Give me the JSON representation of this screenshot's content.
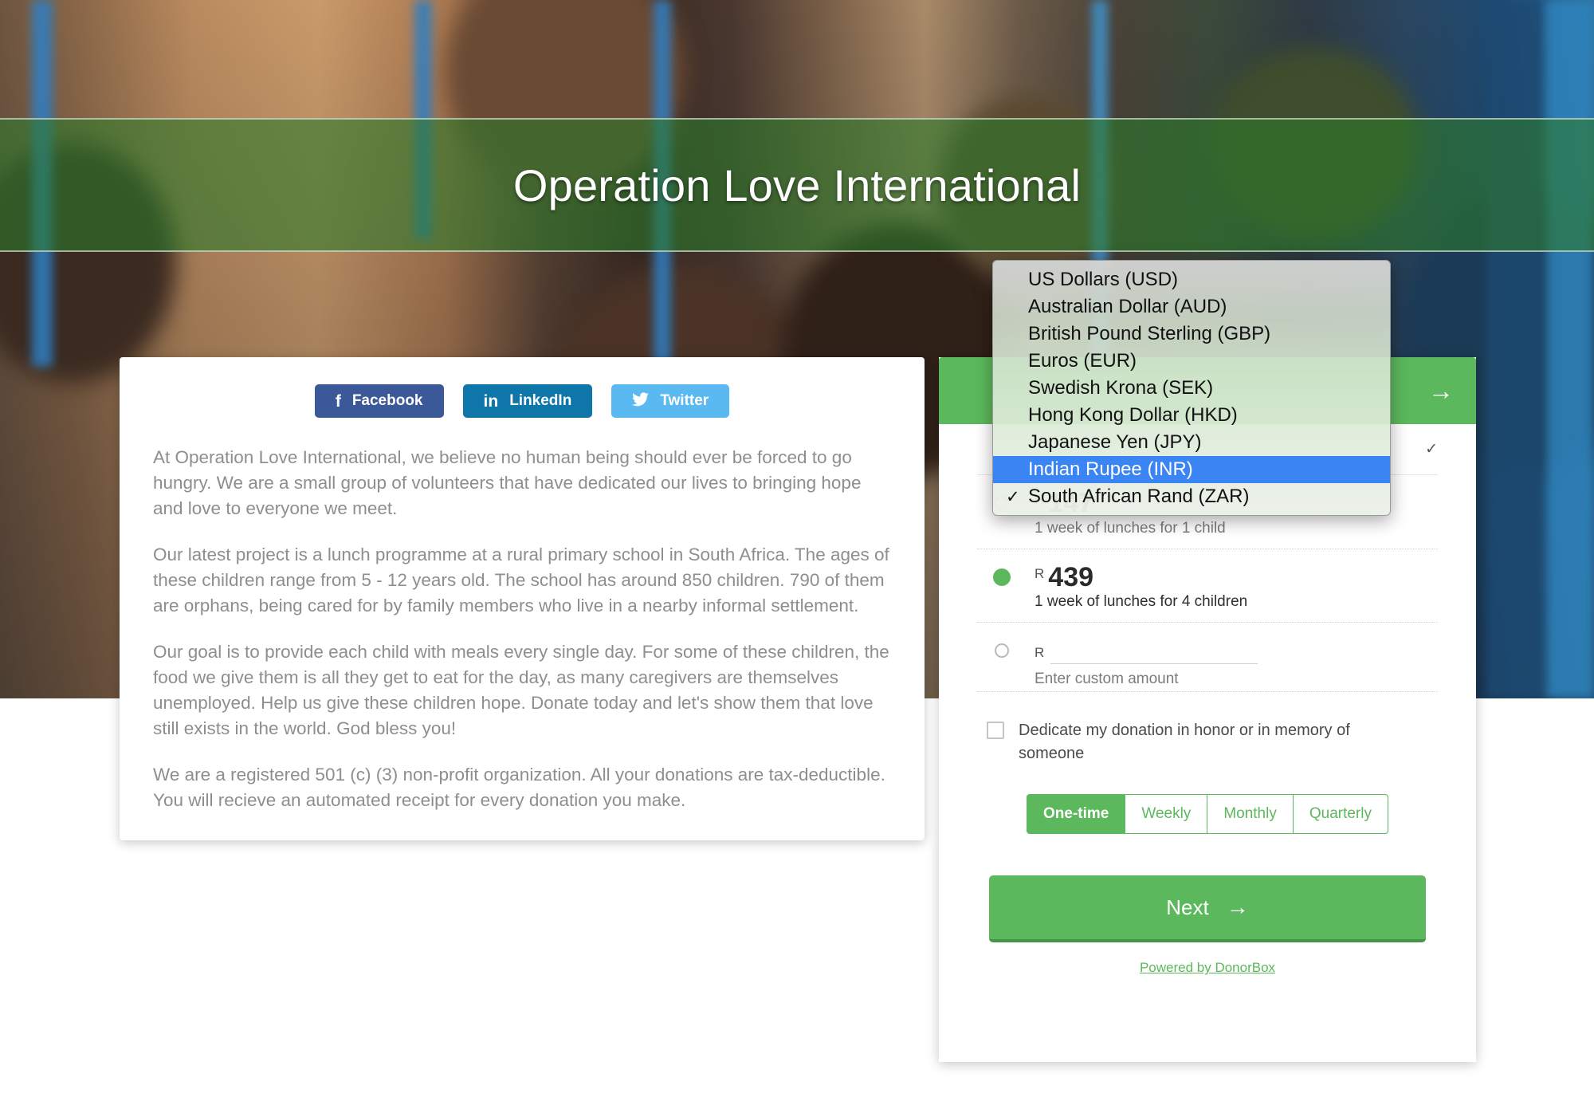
{
  "header": {
    "org_title": "Operation Love International"
  },
  "social": [
    {
      "name": "facebook",
      "label": "Facebook",
      "icon": "facebook-icon",
      "glyph": "f",
      "color": "#3b5998"
    },
    {
      "name": "linkedin",
      "label": "LinkedIn",
      "icon": "linkedin-icon",
      "glyph": "in",
      "color": "#0e76a8"
    },
    {
      "name": "twitter",
      "label": "Twitter",
      "icon": "twitter-icon",
      "glyph": "🐦",
      "color": "#5ab9f0"
    }
  ],
  "content": {
    "paragraphs": [
      "At Operation Love International, we believe no human being should ever be forced to go hungry. We are a small group of volunteers that have dedicated our lives to bringing hope and love to everyone we meet.",
      "Our latest project is a lunch programme at a rural primary school in South Africa. The ages of these children range from 5 - 12 years old. The school has around 850 children. 790 of them are orphans, being cared for by family members who live in a nearby informal settlement.",
      "Our goal is to provide each child with meals every single day. For some of these children, the food we give them is all they get to eat for the day, as many caregivers are themselves unemployed. Help us give these children hope. Donate today and let's show them that love still exists in the world. God bless you!",
      "We are a registered 501 (c) (3) non-profit organization. All your donations are tax-deductible. You will recieve an automated receipt for every donation you make."
    ]
  },
  "donation": {
    "header_arrow": "→",
    "currency_symbol": "R",
    "currency_selected_check": "✓",
    "amounts": [
      {
        "value": "147",
        "description": "1 week of lunches for 1 child",
        "selected": false
      },
      {
        "value": "439",
        "description": "1 week of lunches for 4 children",
        "selected": true
      }
    ],
    "custom": {
      "symbol": "R",
      "value": "",
      "placeholder": "",
      "hint": "Enter custom amount",
      "selected": false
    },
    "dedicate": {
      "label": "Dedicate my donation in honor or in memory of someone",
      "checked": false
    },
    "frequencies": [
      {
        "label": "One-time",
        "active": true
      },
      {
        "label": "Weekly",
        "active": false
      },
      {
        "label": "Monthly",
        "active": false
      },
      {
        "label": "Quarterly",
        "active": false
      }
    ],
    "next_label": "Next",
    "next_arrow": "→",
    "powered_by": "Powered by DonorBox"
  },
  "currency_dropdown": {
    "options": [
      {
        "label": "US Dollars (USD)",
        "checked": false,
        "highlighted": false
      },
      {
        "label": "Australian Dollar (AUD)",
        "checked": false,
        "highlighted": false
      },
      {
        "label": "British Pound Sterling (GBP)",
        "checked": false,
        "highlighted": false
      },
      {
        "label": "Euros (EUR)",
        "checked": false,
        "highlighted": false
      },
      {
        "label": "Swedish Krona (SEK)",
        "checked": false,
        "highlighted": false
      },
      {
        "label": "Hong Kong Dollar (HKD)",
        "checked": false,
        "highlighted": false
      },
      {
        "label": "Japanese Yen (JPY)",
        "checked": false,
        "highlighted": false
      },
      {
        "label": "Indian Rupee (INR)",
        "checked": false,
        "highlighted": true
      },
      {
        "label": "South African Rand (ZAR)",
        "checked": true,
        "highlighted": false
      }
    ],
    "check_glyph": "✓"
  },
  "colors": {
    "brand_green": "#5cb85c",
    "band_green": "#2d7a2b",
    "highlight_blue": "#3a84f4",
    "facebook": "#3b5998",
    "linkedin": "#0e76a8",
    "twitter": "#5ab9f0"
  }
}
